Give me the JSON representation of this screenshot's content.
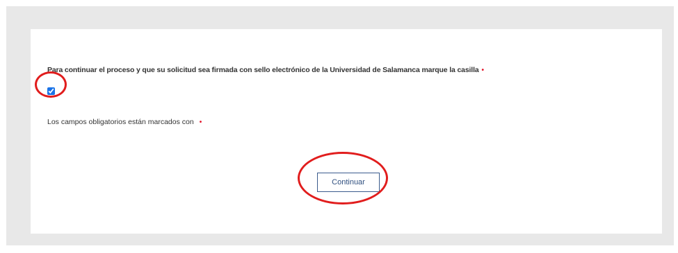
{
  "form": {
    "consent_label": "Para continuar el proceso y que su solicitud sea firmada con sello electrónico de la Universidad de Salamanca marque la casilla",
    "required_marker": "•",
    "consent_checked": true,
    "required_note": "Los campos obligatorios están marcados con",
    "continue_label": "Continuar"
  },
  "colors": {
    "background_panel": "#e8e8e8",
    "card": "#ffffff",
    "required_marker": "#e3152a",
    "button_border": "#3a5a8c",
    "highlight_circle": "#e11d1d"
  }
}
